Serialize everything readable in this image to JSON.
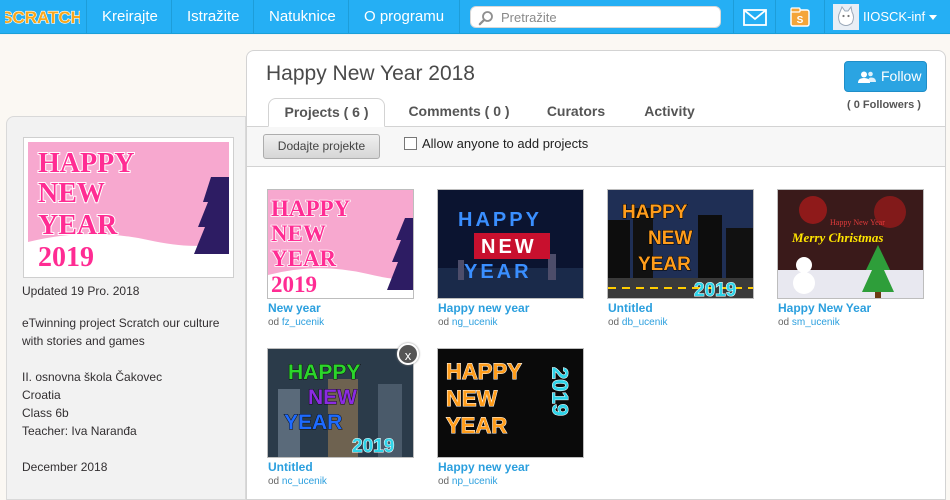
{
  "nav": {
    "logo_text": "SCRATCH",
    "items": [
      "Kreirajte",
      "Istražite",
      "Natuknice",
      "O programu"
    ],
    "search_placeholder": "Pretražite",
    "username": "IIOSCK-inf"
  },
  "studio": {
    "title": "Happy New Year 2018",
    "follow_label": "Follow",
    "followers": "( 0 Followers )",
    "tabs": [
      "Projects ( 6 )",
      "Comments ( 0 )",
      "Curators",
      "Activity"
    ],
    "active_tab": 0,
    "add_projects_label": "Dodajte projekte",
    "allow_label": "Allow anyone to add projects",
    "allow_checked": false
  },
  "sidebar": {
    "updated": "Updated 19 Pro. 2018",
    "description_lines": [
      "eTwinning project Scratch our culture",
      "with stories and games"
    ],
    "details_lines": [
      "II. osnovna škola Čakovec",
      "Croatia",
      "Class 6b",
      "Teacher: Iva Naranđa"
    ],
    "date": "December 2018",
    "image_text": [
      "HAPPY",
      "NEW",
      "YEAR",
      "2019"
    ]
  },
  "projects": [
    {
      "title": "New year",
      "by_prefix": "od",
      "user": "fz_ucenik",
      "art": "pink",
      "lines": [
        "HAPPY",
        "NEW",
        "YEAR",
        "2019"
      ]
    },
    {
      "title": "Happy new year",
      "by_prefix": "od",
      "user": "ng_ucenik",
      "art": "night",
      "lines": [
        "HAPPY",
        "NEW",
        "YEAR"
      ]
    },
    {
      "title": "Untitled",
      "by_prefix": "od",
      "user": "db_ucenik",
      "art": "city",
      "lines": [
        "HAPPY",
        "NEW",
        "YEAR",
        "2019"
      ]
    },
    {
      "title": "Happy New Year",
      "by_prefix": "od",
      "user": "sm_ucenik",
      "art": "xmas",
      "lines": [
        "Merry Christmas",
        "Happy New Year"
      ]
    },
    {
      "title": "Untitled",
      "by_prefix": "od",
      "user": "nc_ucenik",
      "art": "party",
      "lines": [
        "HAPPY",
        "NEW",
        "YEAR",
        "2019"
      ]
    },
    {
      "title": "Happy new year",
      "by_prefix": "od",
      "user": "np_ucenik",
      "art": "black",
      "lines": [
        "HAPPY",
        "NEW",
        "YEAR",
        "2019"
      ]
    }
  ],
  "close_label": "x",
  "colors": {
    "nav_blue": "#25aff4",
    "link_blue": "#2b9fde",
    "follow_blue": "#2ba4e2"
  }
}
